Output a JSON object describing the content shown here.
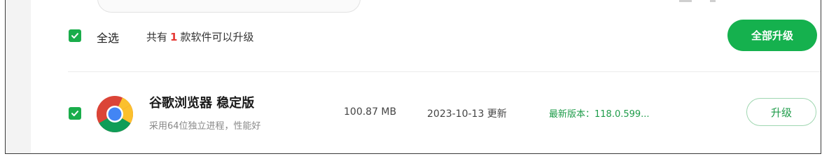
{
  "header": {
    "select_all_label": "全选",
    "summary_prefix": "共有",
    "summary_count": "1",
    "summary_suffix": "款软件可以升级",
    "upgrade_all_label": "全部升级",
    "select_all_checked": true
  },
  "apps": [
    {
      "name": "谷歌浏览器 稳定版",
      "description": "采用64位独立进程，性能好",
      "size": "100.87 MB",
      "update_date": "2023-10-13 更新",
      "latest_version": "最新版本：118.0.599...",
      "upgrade_label": "升级",
      "checked": true,
      "icon": "chrome-icon"
    }
  ],
  "colors": {
    "accent_green": "#15b14e",
    "count_red": "#e53935",
    "version_green": "#1f9c4a"
  }
}
